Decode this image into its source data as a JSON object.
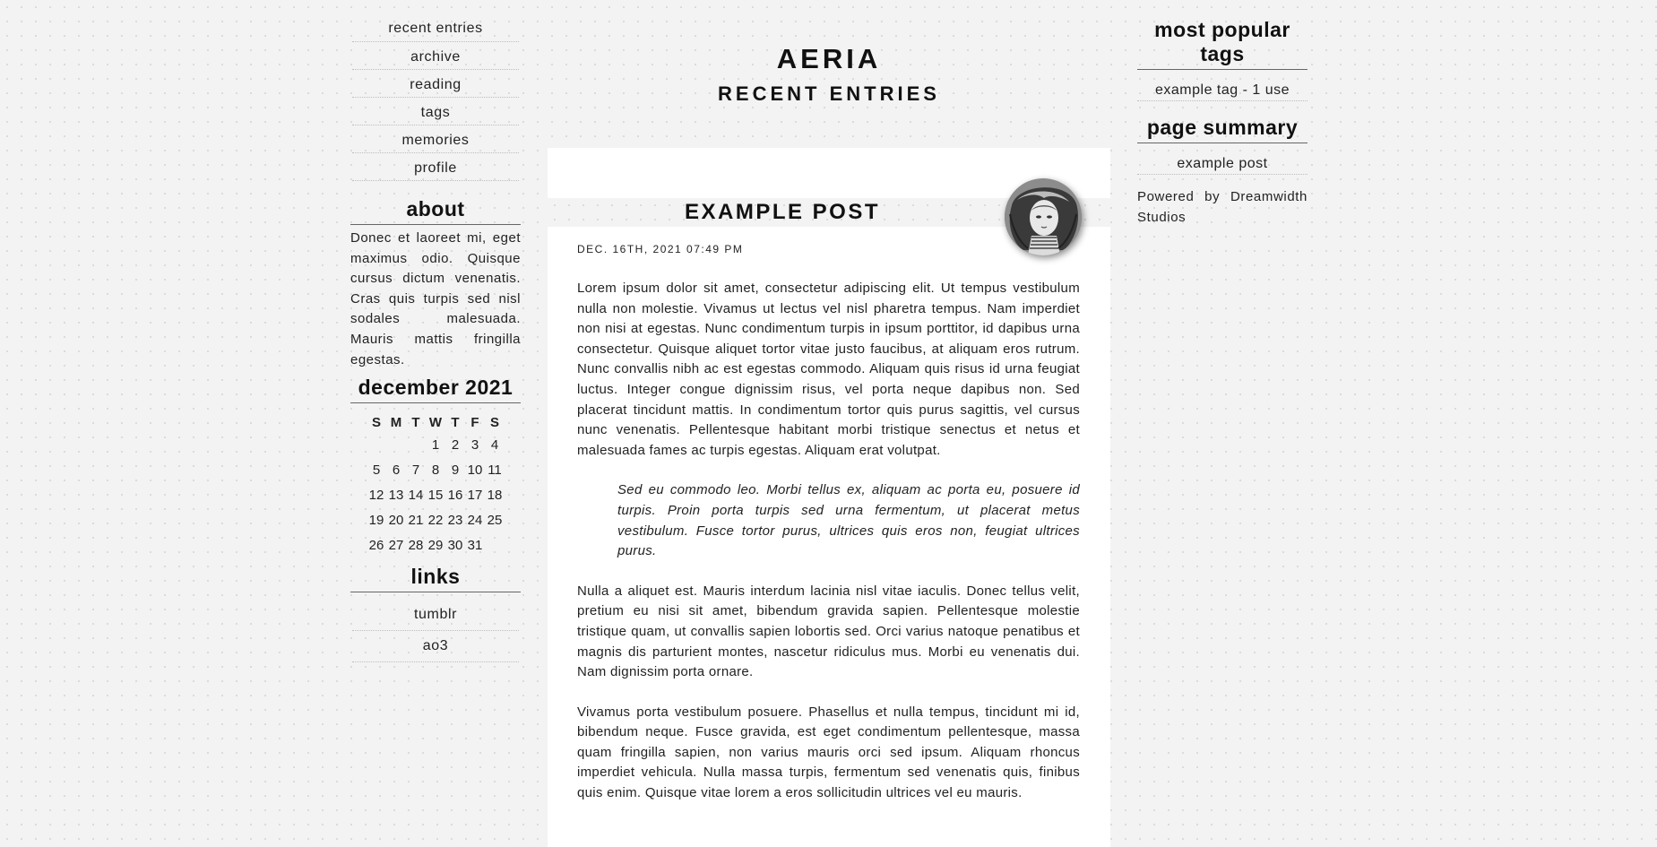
{
  "nav": {
    "items": [
      "recent entries",
      "archive",
      "reading",
      "tags",
      "memories",
      "profile"
    ]
  },
  "about": {
    "title": "about",
    "text": "Donec et laoreet mi, eget maximus odio. Quisque cursus dictum venenatis. Cras quis turpis sed nisl sodales malesuada. Mauris mattis fringilla egestas."
  },
  "calendar": {
    "title": "december 2021",
    "weekdays": [
      "S",
      "M",
      "T",
      "W",
      "T",
      "F",
      "S"
    ],
    "weeks": [
      [
        "",
        "",
        "",
        "1",
        "2",
        "3",
        "4"
      ],
      [
        "5",
        "6",
        "7",
        "8",
        "9",
        "10",
        "11"
      ],
      [
        "12",
        "13",
        "14",
        "15",
        "16",
        "17",
        "18"
      ],
      [
        "19",
        "20",
        "21",
        "22",
        "23",
        "24",
        "25"
      ],
      [
        "26",
        "27",
        "28",
        "29",
        "30",
        "31",
        ""
      ]
    ]
  },
  "links": {
    "title": "links",
    "items": [
      "tumblr",
      "ao3"
    ]
  },
  "header": {
    "site_title": "AERIA",
    "page_title": "RECENT ENTRIES"
  },
  "entry": {
    "title": "EXAMPLE POST",
    "date": "DEC. 16TH, 2021 07:49 PM",
    "userpic_icon": "userpic-illustration",
    "paragraph1": "Lorem ipsum dolor sit amet, consectetur adipiscing elit. Ut tempus vestibulum nulla non molestie. Vivamus ut lectus vel nisl pharetra tempus. Nam imperdiet non nisi at egestas. Nunc condimentum turpis in ipsum porttitor, id dapibus urna consectetur. Quisque aliquet tortor vitae justo faucibus, at aliquam eros rutrum. Nunc convallis nibh ac est egestas commodo. Aliquam quis risus id urna feugiat luctus. Integer congue dignissim risus, vel porta neque dapibus non. Sed placerat tincidunt mattis. In condimentum tortor quis purus sagittis, vel cursus nunc venenatis. Pellentesque habitant morbi tristique senectus et netus et malesuada fames ac turpis egestas. Aliquam erat volutpat.",
    "quote": "Sed eu commodo leo. Morbi tellus ex, aliquam ac porta eu, posuere id turpis. Proin porta turpis sed urna fermentum, ut placerat metus vestibulum. Fusce tortor purus, ultrices quis eros non, feugiat ultrices purus.",
    "paragraph2": "Nulla a aliquet est. Mauris interdum lacinia nisl vitae iaculis. Donec tellus velit, pretium eu nisi sit amet, bibendum gravida sapien. Pellentesque molestie tristique quam, ut convallis sapien lobortis sed. Orci varius natoque penatibus et magnis dis parturient montes, nascetur ridiculus mus. Morbi eu venenatis dui. Nam dignissim porta ornare.",
    "paragraph3": "Vivamus porta vestibulum posuere. Phasellus et nulla tempus, tincidunt mi id, bibendum neque. Fusce gravida, est eget condimentum pellentesque, massa quam fringilla sapien, non varius mauris orci sed ipsum. Aliquam rhoncus imperdiet vehicula. Nulla massa turpis, fermentum sed venenatis quis, finibus quis enim. Quisque vitae lorem a eros sollicitudin ultrices vel eu mauris."
  },
  "tags": {
    "title": "most popular tags",
    "items": [
      "example tag - 1 use"
    ]
  },
  "summary": {
    "title": "page summary",
    "items": [
      "example post"
    ]
  },
  "footer": {
    "powered": "Powered by Dreamwidth Studios"
  }
}
